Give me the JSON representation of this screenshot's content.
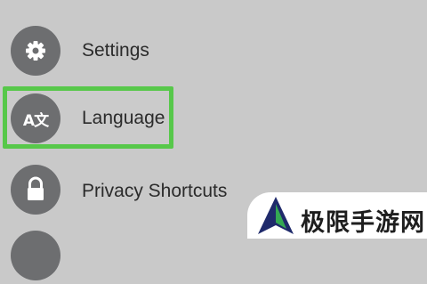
{
  "menu": {
    "items": [
      {
        "label": "Settings",
        "icon": "gear-icon"
      },
      {
        "label": "Language",
        "icon": "language-icon",
        "icon_text": "A文",
        "highlighted": true
      },
      {
        "label": "Privacy Shortcuts",
        "icon": "lock-icon"
      }
    ]
  },
  "watermark": {
    "text": "极限手游网",
    "icon": "watermark-logo"
  },
  "colors": {
    "background": "#c9c9c9",
    "icon_circle": "#6d6e70",
    "highlight": "#57c84a",
    "label": "#2b2b2b"
  }
}
